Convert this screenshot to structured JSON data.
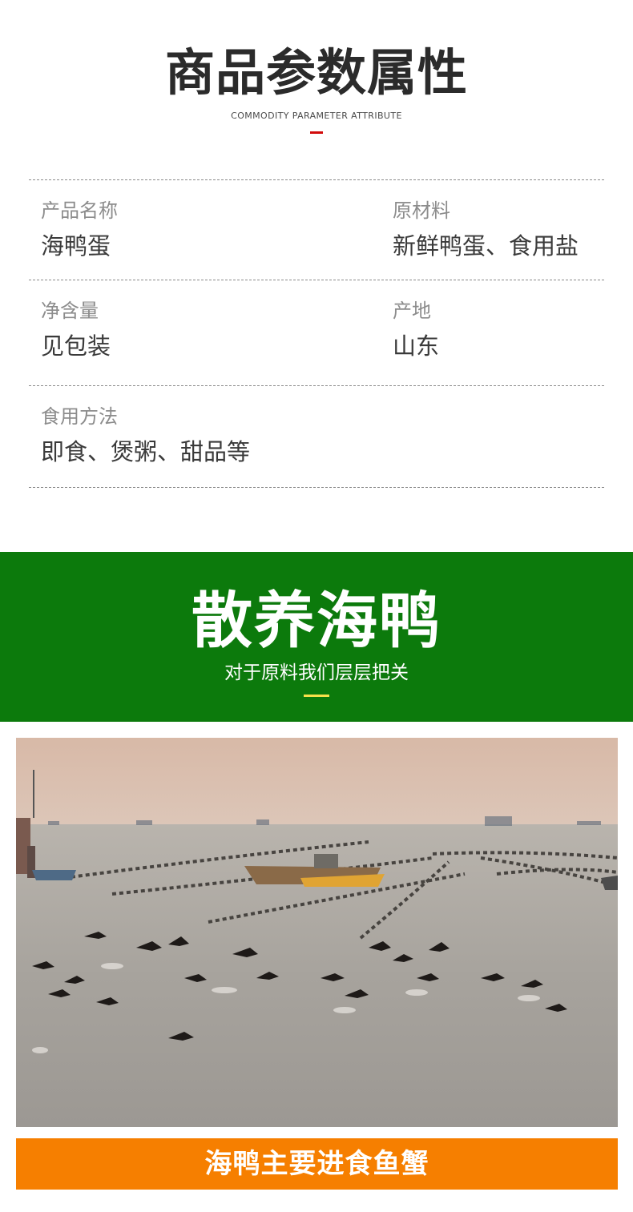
{
  "params_section": {
    "title": "商品参数属性",
    "subtitle": "COMMODITY PARAMETER ATTRIBUTE",
    "accent_color": "#d20b0b",
    "rows": [
      {
        "left": {
          "label": "产品名称",
          "value": "海鸭蛋"
        },
        "right": {
          "label": "原材料",
          "value": "新鲜鸭蛋、食用盐"
        }
      },
      {
        "left": {
          "label": "净含量",
          "value": "见包装"
        },
        "right": {
          "label": "产地",
          "value": "山东"
        }
      },
      {
        "left": {
          "label": "食用方法",
          "value": "即食、煲粥、甜品等"
        }
      }
    ]
  },
  "banner": {
    "title": "散养海鸭",
    "subtitle": "对于原料我们层层把关",
    "background_color": "#0c7a0c",
    "accent_color": "#f7e14a"
  },
  "photo": {
    "icon": "ducks-flying-over-sea-photo"
  },
  "caption": {
    "text": "海鸭主要进食鱼蟹",
    "background_color": "#f67f00"
  }
}
